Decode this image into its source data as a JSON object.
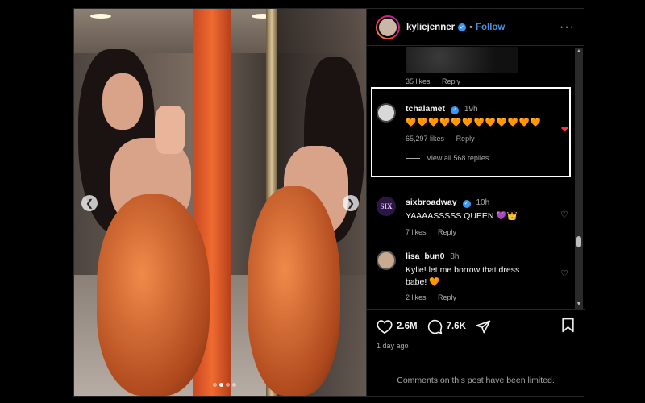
{
  "account": {
    "username": "kyliejenner",
    "follow_label": "Follow",
    "separator": "•"
  },
  "comments": {
    "top": {
      "likes": "35 likes",
      "reply": "Reply"
    },
    "items": [
      {
        "user": "tchalamet",
        "time": "19h",
        "text": "🧡🧡🧡🧡🧡🧡🧡🧡🧡🧡🧡🧡",
        "likes": "65,297 likes",
        "reply": "Reply",
        "liked": true,
        "view_replies": "View all 568 replies",
        "avatar_color": "#d8d8d8"
      },
      {
        "user": "sixbroadway",
        "time": "10h",
        "text": "YAAAASSSSS QUEEN 💜👑",
        "likes": "7 likes",
        "reply": "Reply",
        "liked": false,
        "avatar_color": "#2a1745",
        "avatar_text": "SIX"
      },
      {
        "user": "lisa_bun0",
        "time": "8h",
        "text": "Kylie! let me borrow that dress babe! 🧡",
        "likes": "2 likes",
        "reply": "Reply",
        "liked": false,
        "avatar_color": "#c9a98f"
      }
    ]
  },
  "actions": {
    "likes_count": "2.6M",
    "comments_count": "7.6K",
    "time_ago": "1 day ago"
  },
  "footer": {
    "limited_text": "Comments on this post have been limited."
  },
  "carousel": {
    "prev_icon": "chevron-left-icon",
    "next_icon": "chevron-right-icon",
    "total_slides": 4,
    "current_slide": 2
  },
  "colors": {
    "accent": "#4a90e2",
    "verified": "#3897f0",
    "liked_heart": "#ff3040",
    "muted": "#a8a8a8"
  }
}
